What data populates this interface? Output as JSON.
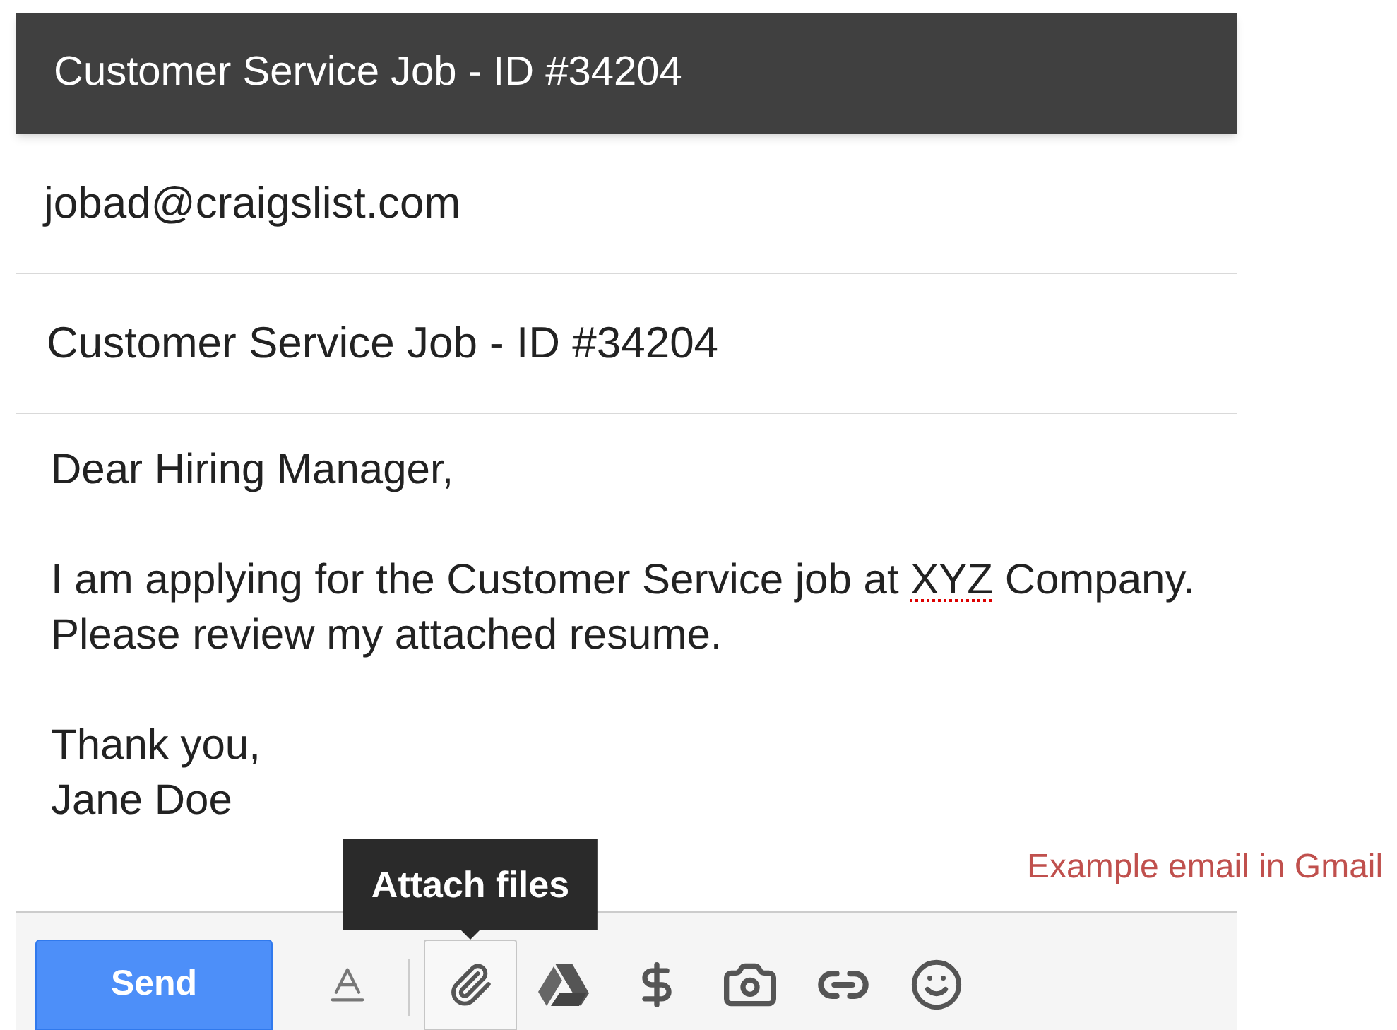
{
  "window": {
    "title": "Customer Service Job - ID #34204"
  },
  "fields": [
    {
      "kind": "to",
      "value": "jobad@craigslist.com"
    },
    {
      "kind": "subject",
      "value": "Customer Service Job - ID #34204"
    }
  ],
  "body": {
    "paragraphs": [
      [
        [
          {
            "text": "Dear Hiring Manager,"
          }
        ]
      ],
      [
        [
          {
            "text": "I am applying for the Customer Service job at "
          },
          {
            "text": "XYZ",
            "misspelled": true
          },
          {
            "text": " Company."
          }
        ],
        [
          {
            "text": "Please review my attached resume."
          }
        ]
      ],
      [
        [
          {
            "text": "Thank you,"
          }
        ],
        [
          {
            "text": "Jane Doe"
          }
        ]
      ]
    ]
  },
  "toolbar": {
    "send_button": "Send",
    "tools": [
      {
        "kind": "format",
        "selected": false
      },
      {
        "kind": "attach",
        "selected": true
      },
      {
        "kind": "drive",
        "selected": false
      },
      {
        "kind": "money",
        "selected": false
      },
      {
        "kind": "photo",
        "selected": false
      },
      {
        "kind": "link",
        "selected": false
      },
      {
        "kind": "emoji",
        "selected": false
      }
    ]
  },
  "tooltip": "Attach files",
  "caption": "Example email in Gmail"
}
